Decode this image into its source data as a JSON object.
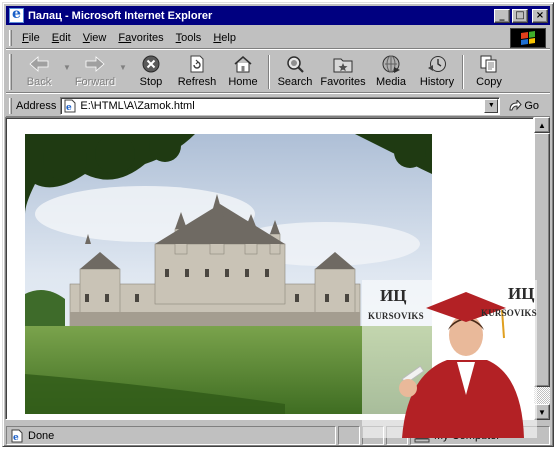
{
  "window": {
    "title": "Палац - Microsoft Internet Explorer",
    "controls": {
      "minimize": "_",
      "maximize": "□",
      "close": "×"
    }
  },
  "menu": {
    "items": [
      {
        "key": "F",
        "rest": "ile"
      },
      {
        "key": "E",
        "rest": "dit"
      },
      {
        "key": "V",
        "rest": "iew"
      },
      {
        "key": "Fa",
        "rest": "vorites",
        "pre": "",
        "underline_index": 1
      },
      {
        "key": "T",
        "rest": "ools"
      },
      {
        "key": "H",
        "rest": "elp"
      }
    ]
  },
  "toolbar": {
    "back": "Back",
    "forward": "Forward",
    "stop": "Stop",
    "refresh": "Refresh",
    "home": "Home",
    "search": "Search",
    "favorites": "Favorites",
    "media": "Media",
    "history": "History",
    "copy": "Copy"
  },
  "address": {
    "label": "Address",
    "value": "E:\\HTML\\A\\Zamok.html",
    "go": "Go"
  },
  "status": {
    "text": "Done",
    "zone": "My Computer"
  },
  "watermark": {
    "logo_left": "ИЦ",
    "brand_left": "KURSOVIKS",
    "logo_right": "ИЦ",
    "brand_right": "KURSOVIKS"
  },
  "colors": {
    "titlebar": "#000080",
    "face": "#c0c0c0",
    "sky": "#d9e4f0",
    "lawn": "#5f8f35"
  }
}
